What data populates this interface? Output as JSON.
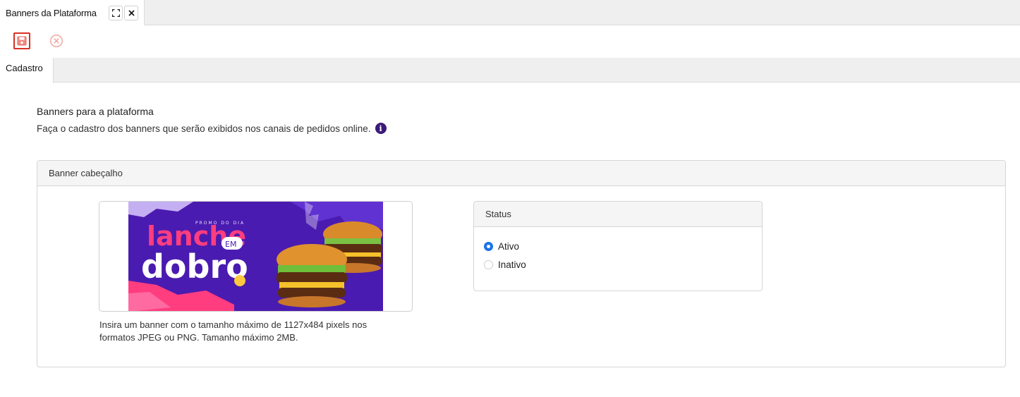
{
  "window_tab": {
    "title": "Banners da Plataforma",
    "maximize_icon": "maximize-icon",
    "close_icon": "close-icon"
  },
  "toolbar": {
    "save_icon": "floppy-disk-icon",
    "cancel_icon": "cancel-circle-icon",
    "save_color": "#d93025",
    "cancel_color": "#f0a8a0"
  },
  "subtabs": [
    {
      "label": "Cadastro"
    }
  ],
  "page": {
    "heading": "Banners para a plataforma",
    "subheading": "Faça o cadastro dos banners que serão exibidos nos canais de pedidos online.",
    "info_icon": "info-icon",
    "accent_color": "#3b1a78"
  },
  "banner_panel": {
    "title": "Banner cabeçalho",
    "image": {
      "small_text": "PROMO DO DIA",
      "word1": "lanche",
      "word2": "EM",
      "word3": "dobro"
    },
    "hint_line1": "Insira um banner com o tamanho máximo de 1127x484 pixels nos",
    "hint_line2": "formatos JPEG ou PNG. Tamanho máximo 2MB."
  },
  "status_panel": {
    "title": "Status",
    "options": [
      {
        "label": "Ativo",
        "selected": true
      },
      {
        "label": "Inativo",
        "selected": false
      }
    ],
    "radio_color": "#1a73e8"
  }
}
